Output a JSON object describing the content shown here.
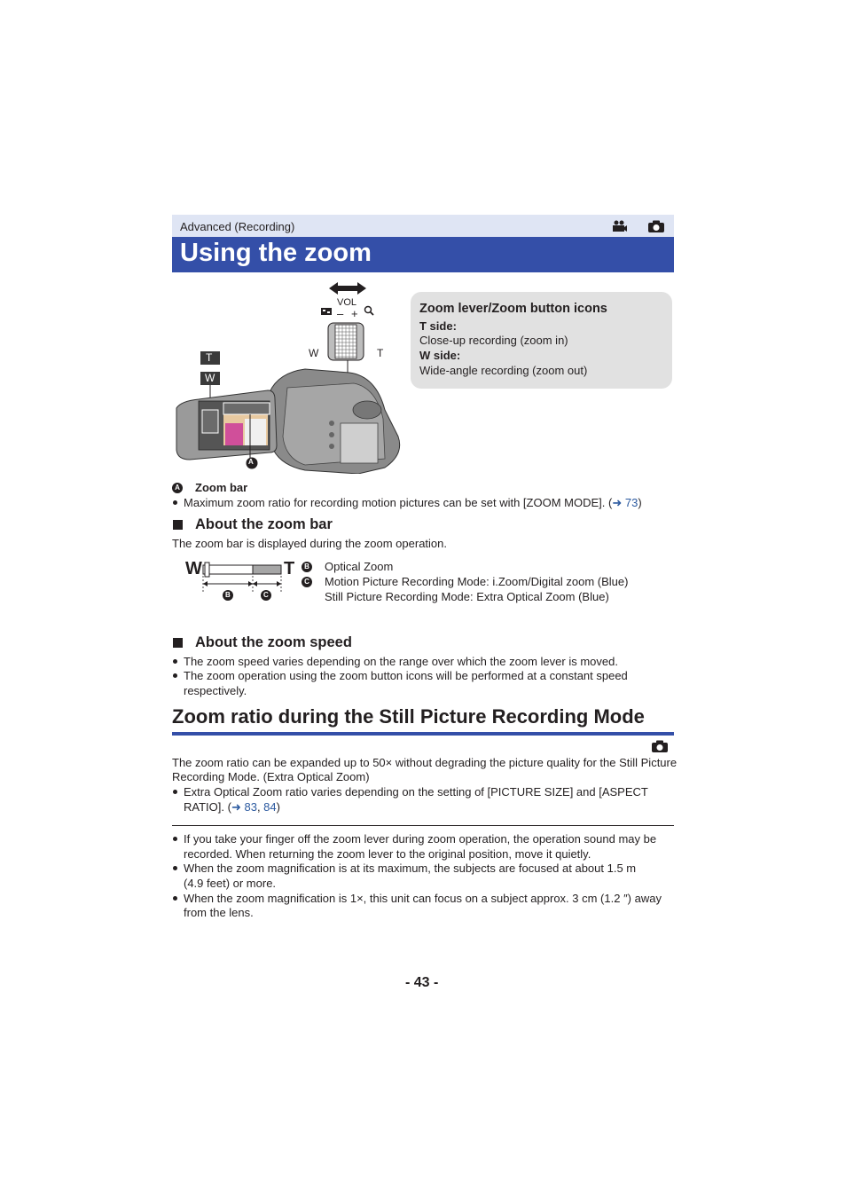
{
  "header": {
    "section_label": "Advanced (Recording)",
    "mode_icons": [
      "motion-picture-icon",
      "camera-icon"
    ],
    "title": "Using the zoom"
  },
  "illustration": {
    "lever_labels": {
      "vol": "VOL",
      "minus": "–",
      "plus": "+",
      "w": "W",
      "t": "T"
    },
    "button_icons": {
      "t": "T",
      "w": "W"
    },
    "callout_letter": "A"
  },
  "callout": {
    "heading": "Zoom lever/Zoom button icons",
    "t_side_label": "T side:",
    "t_side_text": "Close-up recording (zoom in)",
    "w_side_label": "W side:",
    "w_side_text": "Wide-angle recording (zoom out)"
  },
  "zoom_bar_note": {
    "letter": "A",
    "label": "Zoom bar",
    "bullet_text": "Maximum zoom ratio for recording motion pictures can be set with [ZOOM MODE]. (",
    "link_arrow": "➜",
    "link_page": "73",
    "bullet_close": ")"
  },
  "about_zoom_bar": {
    "heading": "About the zoom bar",
    "intro": "The zoom bar is displayed during the zoom operation.",
    "diagram": {
      "w": "W",
      "t": "T",
      "b": "B",
      "c": "C"
    },
    "legend": [
      {
        "letter": "B",
        "text": "Optical Zoom"
      },
      {
        "letter": "C",
        "text": "Motion Picture Recording Mode: i.Zoom/Digital zoom (Blue)"
      },
      {
        "letter": "",
        "text": "Still Picture Recording Mode: Extra Optical Zoom (Blue)"
      }
    ]
  },
  "about_zoom_speed": {
    "heading": "About the zoom speed",
    "bullets": [
      "The zoom speed varies depending on the range over which the zoom lever is moved.",
      "The zoom operation using the zoom button icons will be performed at a constant speed",
      "respectively."
    ]
  },
  "still_section": {
    "heading": "Zoom ratio during the Still Picture Recording Mode",
    "mode_icon": "camera-icon",
    "para_line1": "The zoom ratio can be expanded up to 50× without degrading the picture quality for the Still Picture",
    "para_line2": "Recording Mode. (Extra Optical Zoom)",
    "bullet_line1": "Extra Optical Zoom ratio varies depending on the setting of [PICTURE SIZE] and [ASPECT",
    "bullet_line2_prefix": "RATIO]. (",
    "link_arrow": "➜",
    "link_page1": "83",
    "link_sep": ", ",
    "link_page2": "84",
    "bullet_line2_suffix": ")"
  },
  "notes": [
    {
      "line1": "If you take your finger off the zoom lever during zoom operation, the operation sound may be",
      "line2": "recorded. When returning the zoom lever to the original position, move it quietly."
    },
    {
      "line1": "When the zoom magnification is at its maximum, the subjects are focused at about 1.5 m",
      "line2": "(4.9 feet) or more."
    },
    {
      "line1": "When the zoom magnification is 1×, this unit can focus on a subject approx. 3 cm (1.2 ″) away",
      "line2": "from the lens."
    }
  ],
  "footer": {
    "page_number": "- 43 -"
  },
  "colors": {
    "brand_blue": "#344fa8",
    "section_bg": "#dfe5f4",
    "callout_bg": "#e1e1e1",
    "link": "#2c5aa0"
  }
}
